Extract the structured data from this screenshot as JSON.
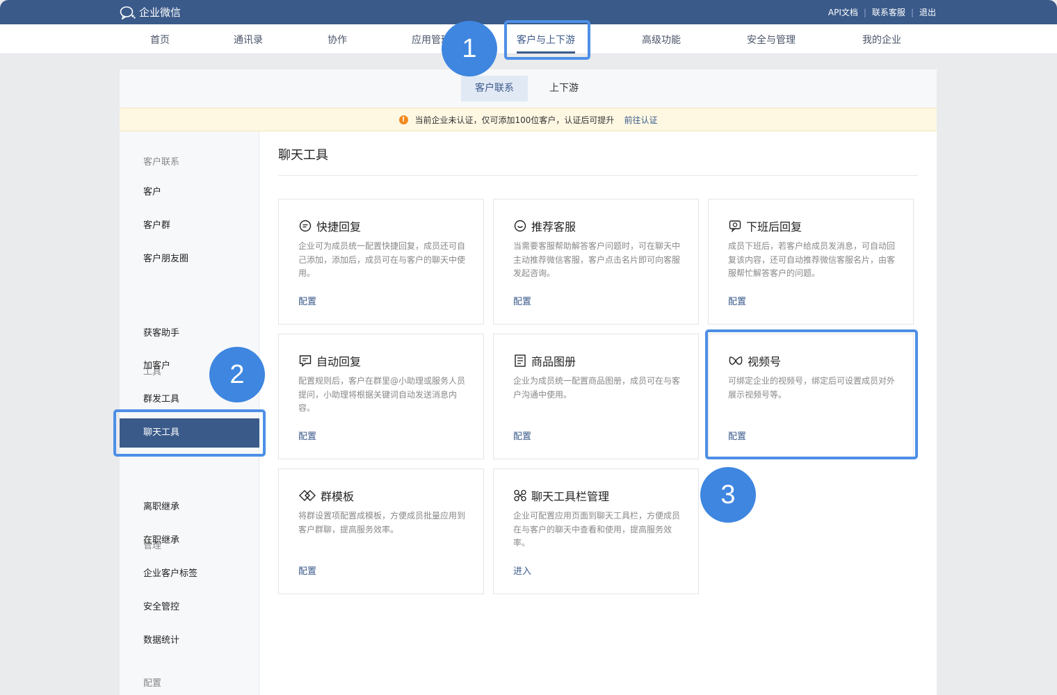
{
  "topbar": {
    "logo_text": "企业微信",
    "links": [
      "API文档",
      "联系客服",
      "退出"
    ]
  },
  "nav": {
    "items": [
      "首页",
      "通讯录",
      "协作",
      "应用管理",
      "客户与上下游",
      "高级功能",
      "安全与管理",
      "我的企业"
    ],
    "active": "客户与上下游"
  },
  "subtabs": {
    "items": [
      "客户联系",
      "上下游"
    ],
    "active": "客户联系"
  },
  "notice": {
    "text": "当前企业未认证，仅可添加100位客户，认证后可提升",
    "link": "前往认证"
  },
  "sidebar": {
    "groups": [
      {
        "label": "客户联系",
        "items": [
          "客户",
          "客户群",
          "客户朋友圈"
        ]
      },
      {
        "label": "工具",
        "items": [
          "获客助手",
          "加客户",
          "群发工具",
          "聊天工具"
        ]
      },
      {
        "label": "管理",
        "items": [
          "离职继承",
          "在职继承",
          "企业客户标签",
          "安全管控",
          "数据统计"
        ]
      },
      {
        "label": "配置",
        "items": []
      }
    ],
    "active": "聊天工具"
  },
  "content": {
    "title": "聊天工具",
    "cards": [
      {
        "icon": "quick-reply-icon",
        "title": "快捷回复",
        "desc": "企业可为成员统一配置快捷回复，成员还可自己添加，添加后，成员可在与客户的聊天中使用。",
        "action": "配置"
      },
      {
        "icon": "recommend-service-icon",
        "title": "推荐客服",
        "desc": "当需要客服帮助解答客户问题时，可在聊天中主动推荐微信客服，客户点击名片即可向客服发起咨询。",
        "action": "配置"
      },
      {
        "icon": "after-work-reply-icon",
        "title": "下班后回复",
        "desc": "成员下班后，若客户给成员发消息，可自动回复该内容，还可自动推荐微信客服名片，由客服帮忙解答客户的问题。",
        "action": "配置"
      },
      {
        "icon": "auto-reply-icon",
        "title": "自动回复",
        "desc": "配置规则后，客户在群里@小助理或服务人员提问，小助理将根据关键词自动发送消息内容。",
        "action": "配置"
      },
      {
        "icon": "product-album-icon",
        "title": "商品图册",
        "desc": "企业为成员统一配置商品图册，成员可在与客户沟通中使用。",
        "action": "配置"
      },
      {
        "icon": "channels-icon",
        "title": "视频号",
        "desc": "可绑定企业的视频号，绑定后可设置成员对外展示视频号等。",
        "action": "配置"
      },
      {
        "icon": "group-template-icon",
        "title": "群模板",
        "desc": "将群设置项配置成模板，方便成员批量应用到客户群聊，提高服务效率。",
        "action": "配置"
      },
      {
        "icon": "toolbar-manage-icon",
        "title": "聊天工具栏管理",
        "desc": "企业可配置应用页面到聊天工具栏，方便成员在与客户的聊天中查看和使用，提高服务效率。",
        "action": "进入"
      }
    ]
  },
  "annotations": [
    "1",
    "2",
    "3"
  ]
}
